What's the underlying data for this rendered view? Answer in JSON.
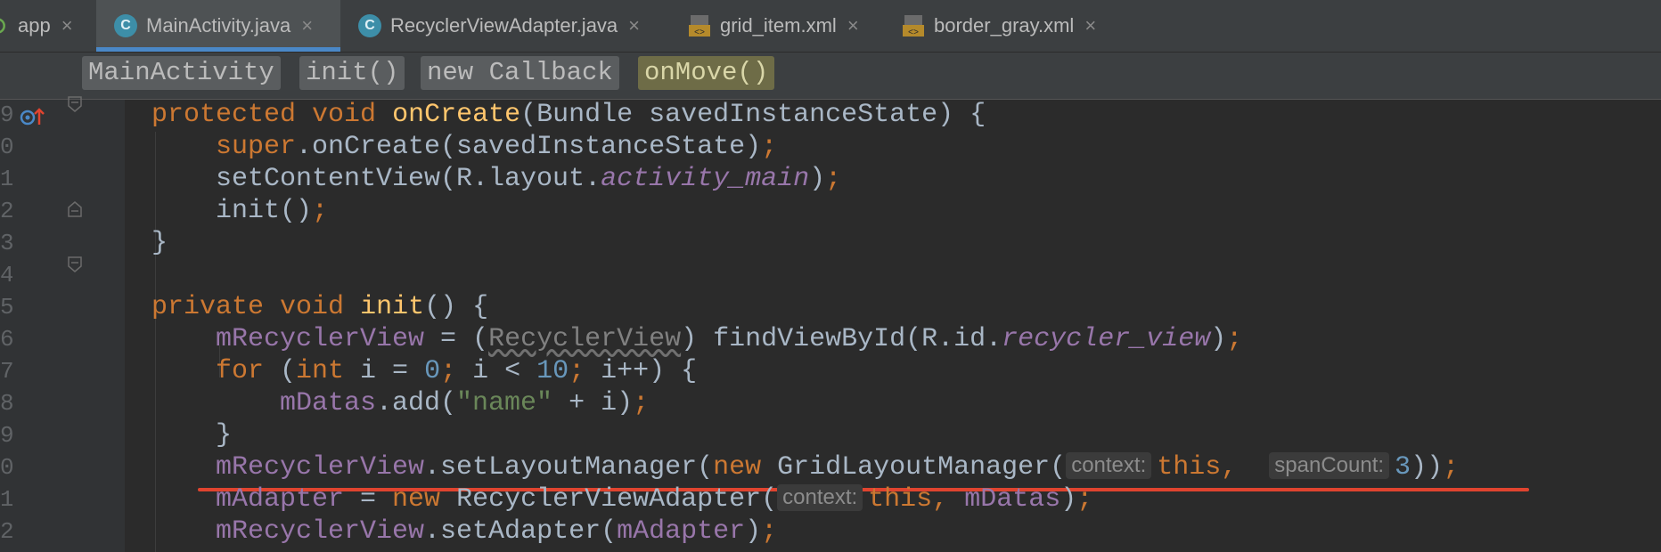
{
  "tabs": [
    {
      "label": "app",
      "icon": "android-module-icon",
      "active": false
    },
    {
      "label": "MainActivity.java",
      "icon": "class-icon",
      "active": true
    },
    {
      "label": "RecyclerViewAdapter.java",
      "icon": "class-icon",
      "active": false
    },
    {
      "label": "grid_item.xml",
      "icon": "xml-file-icon",
      "active": false
    },
    {
      "label": "border_gray.xml",
      "icon": "xml-file-icon",
      "active": false
    }
  ],
  "tab_close_glyph": "×",
  "class_icon_letter": "C",
  "breadcrumbs": [
    "MainActivity",
    "init()",
    "new Callback",
    "onMove()"
  ],
  "line_numbers": [
    "9",
    "0",
    "1",
    "2",
    "3",
    "4",
    "5",
    "6",
    "7",
    "8",
    "9",
    "0",
    "1",
    "2"
  ],
  "code": {
    "l1": {
      "kw1": "protected",
      "kw2": "void",
      "fn": "onCreate",
      "rest": "(Bundle savedInstanceState) {"
    },
    "l2": {
      "kw": "super",
      "rest": ".onCreate(savedInstanceState)",
      "semi": ";"
    },
    "l3": {
      "a": "setContentView(R.layout.",
      "ital": "activity_main",
      "b": ")",
      "semi": ";"
    },
    "l4": {
      "a": "init()",
      "semi": ";"
    },
    "l5": {
      "a": "}"
    },
    "l7": {
      "kw1": "private",
      "kw2": "void",
      "fn": "init",
      "rest": "() {"
    },
    "l8": {
      "fld": "mRecyclerView",
      "eq": " = (",
      "cast": "RecyclerView",
      "b": ") findViewById(R.id.",
      "ital": "recycler_view",
      "c": ")",
      "semi": ";"
    },
    "l9": {
      "kw": "for",
      "a": " (",
      "kw2": "int",
      "b": " i = ",
      "n1": "0",
      "semi1": ";",
      "c": " i < ",
      "n2": "10",
      "semi2": ";",
      "d": " i++) {"
    },
    "l10": {
      "fld": "mDatas",
      "a": ".add(",
      "str": "\"name\"",
      "b": " + i)",
      "semi": ";"
    },
    "l11": {
      "a": "}"
    },
    "l12": {
      "fld": "mRecyclerView",
      "a": ".setLayoutManager(",
      "kw": "new",
      "b": " GridLayoutManager(",
      "hint1": "context:",
      "kw2": "this",
      "comma": ",",
      "hint2": "spanCount:",
      "n": "3",
      "c": "))",
      "semi": ";"
    },
    "l13": {
      "fld": "mAdapter",
      "a": " = ",
      "kw": "new",
      "b": " RecyclerViewAdapter(",
      "hint": "context:",
      "kw2": "this",
      "comma": ",",
      "fld2": "mDatas",
      "c": ")",
      "semi": ";"
    },
    "l14": {
      "fld": "mRecyclerView",
      "a": ".setAdapter(",
      "fld2": "mAdapter",
      "c": ")",
      "semi": ";"
    }
  },
  "colors": {
    "background": "#2b2b2b",
    "keyword": "#cc7832",
    "method": "#ffc66d",
    "field": "#9876aa",
    "number": "#6897bb",
    "string": "#6a8759",
    "error_underline": "#e0442f",
    "active_tab_indicator": "#4a88c7"
  }
}
